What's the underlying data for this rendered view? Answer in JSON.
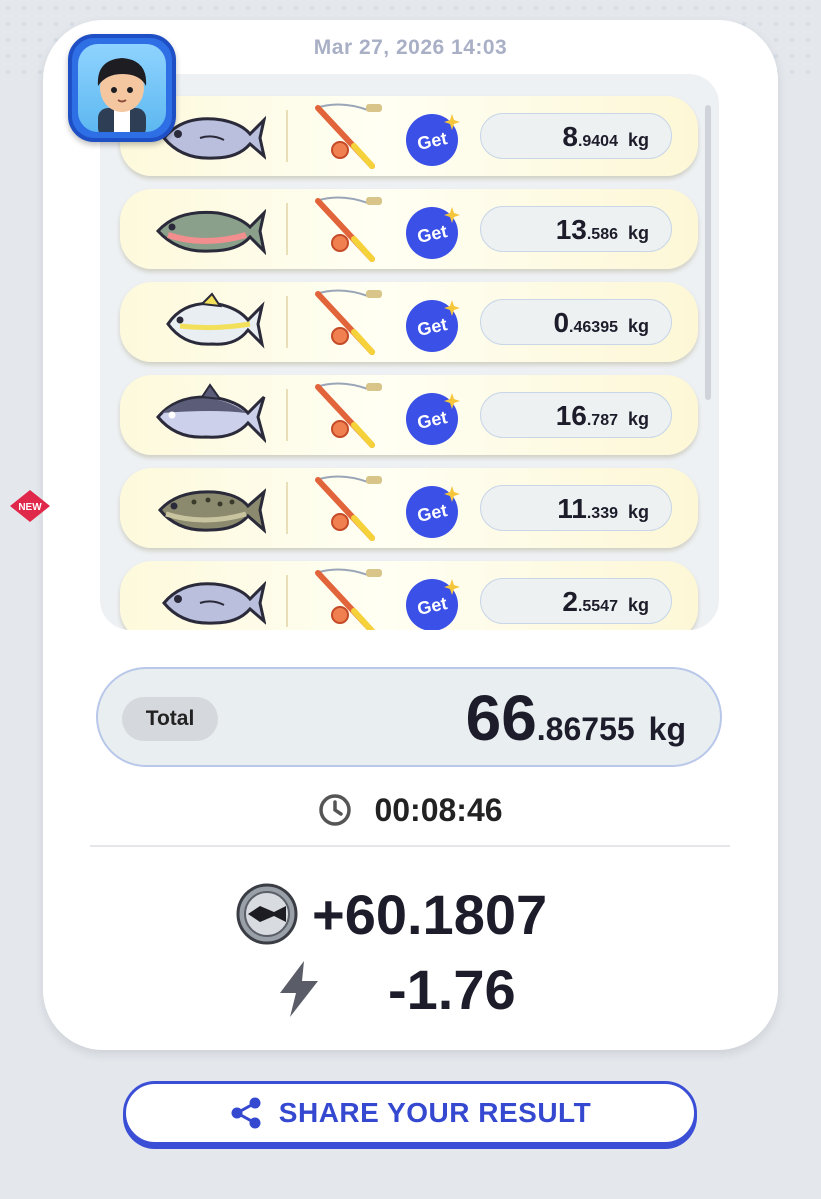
{
  "header": {
    "timestamp": "Mar 27, 2026 14:03"
  },
  "catches": [
    {
      "fish_icon": "silver-fish-icon",
      "badge": "",
      "weight_int": "8",
      "weight_dec": ".9404",
      "unit": "kg",
      "get_label": "Get"
    },
    {
      "fish_icon": "trout-fish-icon",
      "badge": "",
      "weight_int": "13",
      "weight_dec": ".586",
      "unit": "kg",
      "get_label": "Get"
    },
    {
      "fish_icon": "yellowtail-fish-icon",
      "badge": "",
      "weight_int": "0",
      "weight_dec": ".46395",
      "unit": "kg",
      "get_label": "Get"
    },
    {
      "fish_icon": "purple-fish-icon",
      "badge": "",
      "weight_int": "16",
      "weight_dec": ".787",
      "unit": "kg",
      "get_label": "Get"
    },
    {
      "fish_icon": "spotted-trout-icon",
      "badge": "NEW",
      "weight_int": "11",
      "weight_dec": ".339",
      "unit": "kg",
      "get_label": "Get"
    },
    {
      "fish_icon": "silver-fish-icon",
      "badge": "",
      "weight_int": "2",
      "weight_dec": ".5547",
      "unit": "kg",
      "get_label": "Get"
    }
  ],
  "total": {
    "label": "Total",
    "int": "66",
    "dec": ".86755",
    "unit": "kg"
  },
  "timer": {
    "icon": "clock-icon",
    "value": "00:08:46"
  },
  "reward": {
    "icon": "token-coin-icon",
    "value": "+60.1807"
  },
  "energy": {
    "icon": "lightning-icon",
    "value": "-1.76"
  },
  "share": {
    "icon": "share-icon",
    "label": "SHARE YOUR RESULT"
  },
  "colors": {
    "accent": "#3b4fd6",
    "get_badge": "#3b50e6",
    "row_bg": "#fdf9dc"
  }
}
